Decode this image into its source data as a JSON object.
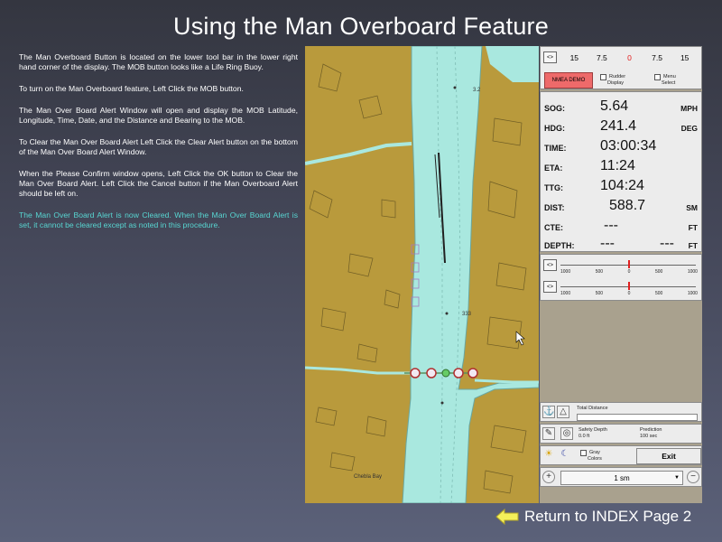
{
  "page": {
    "title": "Using the Man Overboard Feature",
    "instructions": [
      "The Man Overboard Button is located on the lower tool bar in the lower right hand corner of the display.   The MOB button looks like a Life Ring Buoy.",
      "To turn on the Man Overboard feature, Left Click the MOB button.",
      "The Man Over Board Alert Window will open and display the MOB Latitude, Longitude, Time, Date, and the Distance and Bearing to the MOB.",
      "To Clear the Man Over Board  Alert Left Click the Clear Alert button on the bottom of the Man Over Board Alert Window.",
      "When the Please Confirm window opens, Left Click the OK button to Clear the Man Over Board Alert.  Left Click the Cancel button if the Man Overboard Alert should be left on."
    ],
    "note": "The Man Over Board Alert is now Cleared.  When the Man Over Board Alert is set, it cannot be cleared except as noted in this procedure.",
    "return_link": "Return to INDEX Page 2"
  },
  "map": {
    "labels": {
      "depth_a": "3.2",
      "depth_b": "333",
      "place": "Chebla Bay"
    }
  },
  "panel": {
    "scale_ticks": [
      "15",
      "7.5",
      "0",
      "7.5",
      "15"
    ],
    "scale_button": "<>",
    "nmea_button": "NMEA DEMO",
    "rudder_display": [
      "Rudder",
      "Display"
    ],
    "menu_select": [
      "Menu",
      "Select"
    ],
    "rows": [
      {
        "label": "SOG:",
        "value": "5.64",
        "unit": "MPH"
      },
      {
        "label": "HDG:",
        "value": "241.4",
        "unit": "DEG"
      },
      {
        "label": "TIME:",
        "value": "03:00:34",
        "unit": ""
      },
      {
        "label": "ETA:",
        "value": "11:24",
        "unit": ""
      },
      {
        "label": "TTG:",
        "value": "104:24",
        "unit": ""
      },
      {
        "label": "DIST:",
        "value": "588.7",
        "unit": "SM"
      },
      {
        "label": "CTE:",
        "value": "---",
        "unit": "FT"
      },
      {
        "label": "DEPTH:",
        "value": "---",
        "value2": "---",
        "unit": "FT"
      }
    ],
    "slider_labels": [
      "1000",
      "500",
      "0",
      "500",
      "1000"
    ],
    "slider_button": "<>",
    "total_distance": "Total Distance",
    "safety_depth_label": "Safety Depth",
    "safety_depth_value": "0.0 ft",
    "prediction_label": "Prediction",
    "prediction_value": "100 sec",
    "gray_colors": [
      "Gray",
      "Colors"
    ],
    "exit": "Exit",
    "zoom_value": "1 sm",
    "colors": {
      "nmea": "#ee6a6a",
      "water": "#a9e8df",
      "land": "#b99a3c",
      "slider_marker": "#e02020"
    }
  }
}
